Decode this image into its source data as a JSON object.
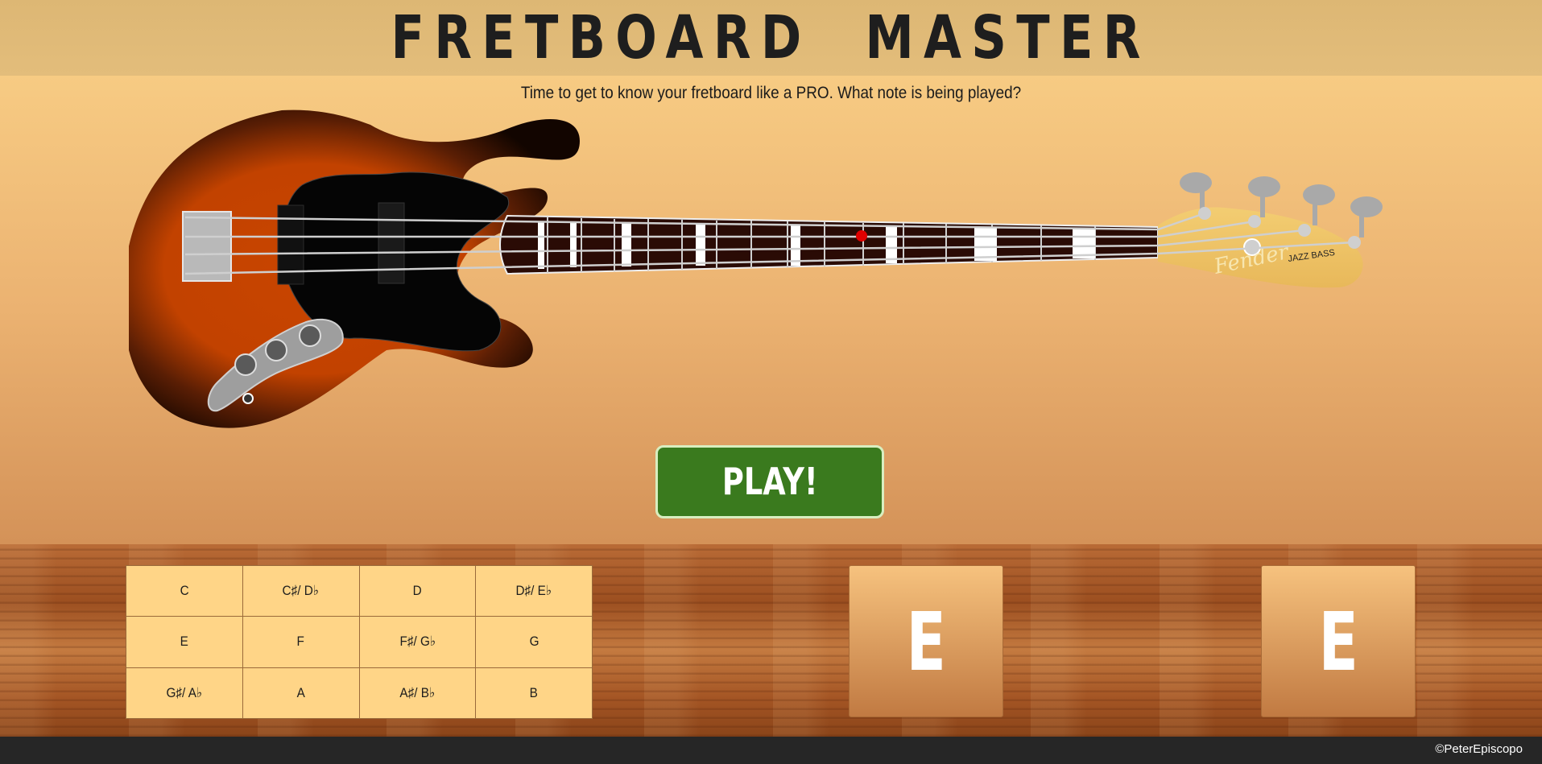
{
  "header": {
    "title": "FRETBOARD  MASTER"
  },
  "subtitle": "Time to get to know your fretboard like a PRO. What note is being played?",
  "bass": {
    "brand": "Fender",
    "model": "JAZZ BASS"
  },
  "play_button": {
    "label": "PLAY!"
  },
  "note_grid": {
    "rows": [
      [
        {
          "name": "C"
        },
        {
          "name": "C♯/ D♭"
        },
        {
          "name": "D"
        },
        {
          "name": "D♯/ E♭"
        }
      ],
      [
        {
          "name": "E"
        },
        {
          "name": "F"
        },
        {
          "name": "F♯/ G♭"
        },
        {
          "name": "G"
        }
      ],
      [
        {
          "name": "G♯/ A♭"
        },
        {
          "name": "A"
        },
        {
          "name": "A♯/ B♭"
        },
        {
          "name": "B"
        }
      ]
    ]
  },
  "answer_cards": [
    {
      "note": "E"
    },
    {
      "note": "E"
    }
  ],
  "footer": {
    "credit": "©PeterEpiscopo"
  },
  "colors": {
    "play_button": "#3a7a1e",
    "note_cell": "#ffd587",
    "marker": "#e00000",
    "footer": "#262626"
  }
}
